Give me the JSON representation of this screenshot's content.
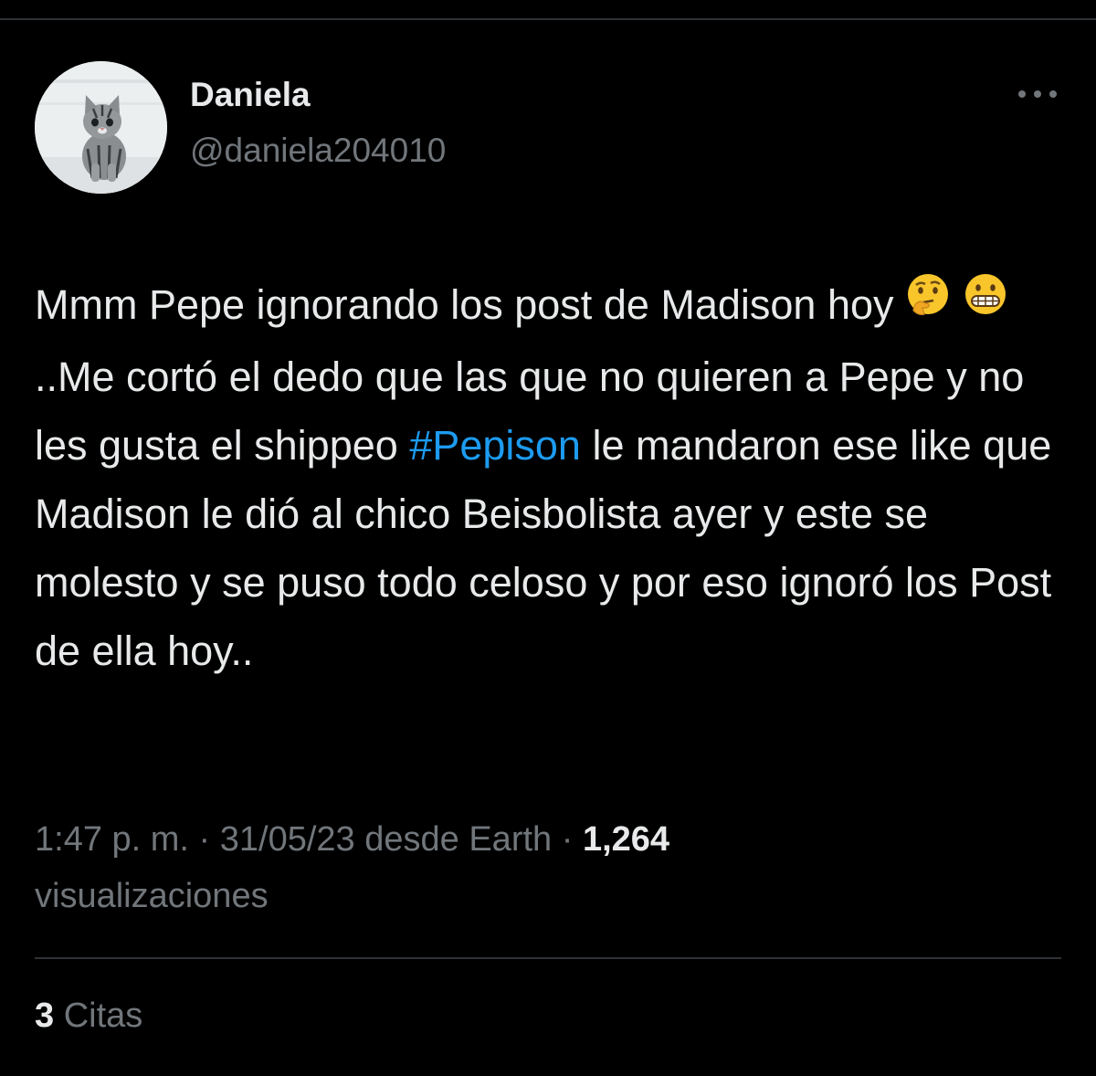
{
  "author": {
    "display_name": "Daniela",
    "handle": "@daniela204010",
    "avatar_icon": "kitten-avatar"
  },
  "menu": {
    "icon": "more-horizontal-icon"
  },
  "tweet": {
    "text_before_emoji": "Mmm Pepe ignorando los post de Madison hoy ",
    "emoji_1": "thinking-face-emoji",
    "emoji_2": "grimacing-face-emoji",
    "text_after_emoji": " ..Me cortó el dedo que las que no quieren a Pepe y no les gusta el shippeo ",
    "hashtag": "#Pepison",
    "text_after_hashtag": " le mandaron ese like que Madison le dió al chico Beisbolista ayer y este se molesto y se puso todo celoso y por eso ignoró los Post de ella hoy.."
  },
  "meta": {
    "time": "1:47 p. m.",
    "separator_1": " · ",
    "date": "31/05/23",
    "source": " desde Earth",
    "separator_2": " · ",
    "views_count": "1,264",
    "views_label": "visualizaciones"
  },
  "quotes": {
    "count": "3",
    "label": "Citas"
  },
  "colors": {
    "background": "#000000",
    "text_primary": "#e7e9ea",
    "text_secondary": "#71767b",
    "link": "#1d9bf0",
    "divider": "#2f3336"
  }
}
